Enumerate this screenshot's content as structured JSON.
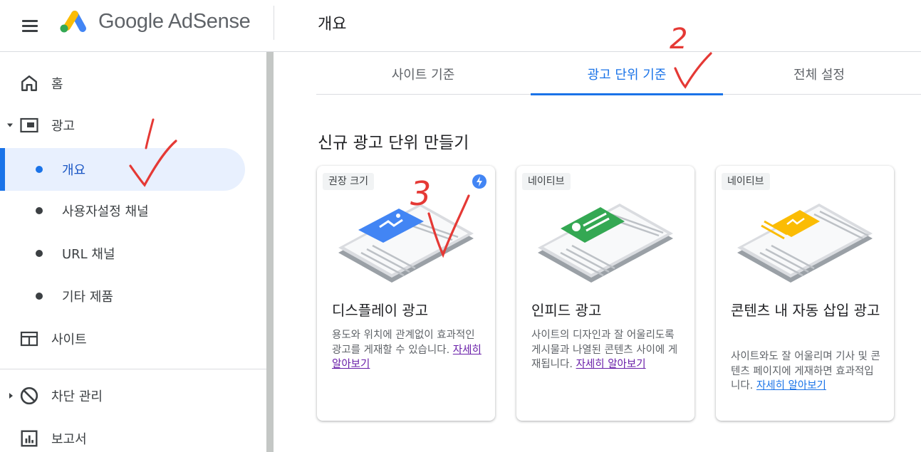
{
  "app": {
    "logo_text": "Google AdSense",
    "page_title": "개요"
  },
  "sidebar": {
    "items": [
      {
        "label": "홈",
        "icon": "home-icon"
      },
      {
        "label": "광고",
        "icon": "ads-icon"
      },
      {
        "label": "개요",
        "active": true
      },
      {
        "label": "사용자설정 채널"
      },
      {
        "label": "URL 채널"
      },
      {
        "label": "기타 제품"
      },
      {
        "label": "사이트",
        "icon": "sites-icon"
      },
      {
        "label": "차단 관리",
        "icon": "block-icon"
      },
      {
        "label": "보고서",
        "icon": "reports-icon"
      }
    ]
  },
  "tabs": [
    {
      "label": "사이트 기준"
    },
    {
      "label": "광고 단위 기준",
      "active": true
    },
    {
      "label": "전체 설정"
    }
  ],
  "section_title": "신규 광고 단위 만들기",
  "cards": [
    {
      "badge": "권장 크기",
      "title": "디스플레이 광고",
      "desc": "용도와 위치에 관계없이 효과적인 광고를 게재할 수 있습니다.",
      "more": "자세히 알아보기"
    },
    {
      "badge": "네이티브",
      "title": "인피드 광고",
      "desc": "사이트의 디자인과 잘 어울리도록 게시물과 나열된 콘텐츠 사이에 게재됩니다.",
      "more": "자세히 알아보기"
    },
    {
      "badge": "네이티브",
      "title": "콘텐츠 내 자동 삽입 광고",
      "desc": "사이트와도 잘 어울리며 기사 및 콘텐츠 페이지에 게재하면 효과적입니다.",
      "more": "자세히 알아보기"
    }
  ],
  "annotations": [
    "2",
    "3"
  ],
  "colors": {
    "accent": "#1a73e8",
    "active_bg": "#e8f0fe",
    "annotation": "#e53935"
  }
}
